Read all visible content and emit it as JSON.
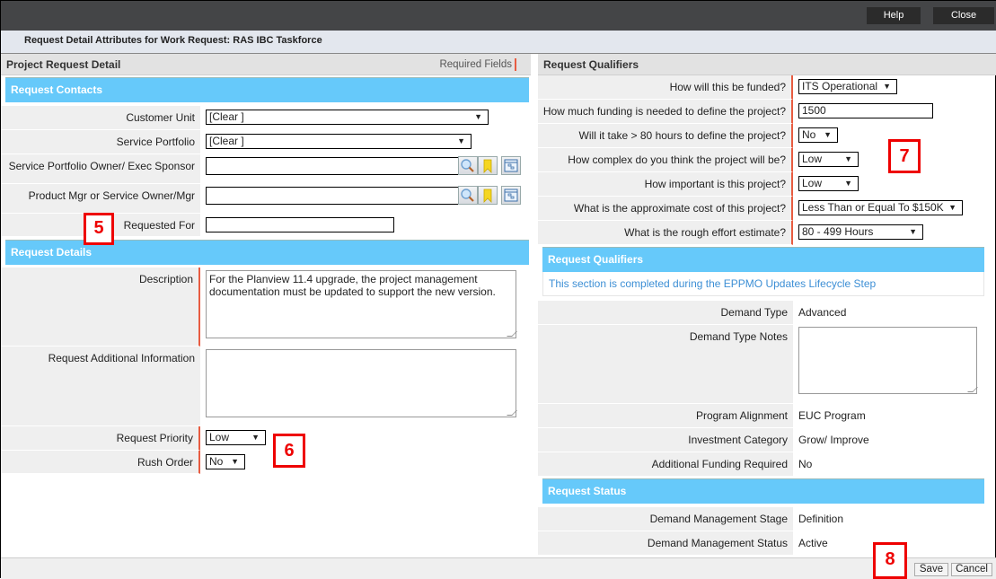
{
  "topbar": {
    "help_label": "Help",
    "close_label": "Close"
  },
  "subbar": {
    "title": "Request Detail Attributes for Work Request: RAS IBC Taskforce"
  },
  "left": {
    "panel_title": "Project Request Detail",
    "required_fields": "Required Fields",
    "contacts": {
      "section_title": "Request Contacts",
      "customer_unit": {
        "label": "Customer Unit",
        "value": "[Clear ]"
      },
      "service_portfolio": {
        "label": "Service Portfolio",
        "value": "[Clear ]"
      },
      "portfolio_owner": {
        "label": "Service Portfolio Owner/ Exec Sponsor",
        "value": ""
      },
      "product_mgr": {
        "label": "Product Mgr or Service Owner/Mgr",
        "value": ""
      },
      "requested_for": {
        "label": "Requested For",
        "value": ""
      }
    },
    "details": {
      "section_title": "Request Details",
      "description": {
        "label": "Description",
        "value": "For the Planview 11.4 upgrade, the project management documentation must be updated to support the new version."
      },
      "additional_info": {
        "label": "Request Additional Information",
        "value": ""
      },
      "priority": {
        "label": "Request Priority",
        "value": "Low"
      },
      "rush_order": {
        "label": "Rush Order",
        "value": "No"
      }
    }
  },
  "right": {
    "panel_title": "Request Qualifiers",
    "questions": [
      {
        "label": "How will this be funded?",
        "value": "ITS Operational"
      },
      {
        "label": "How much funding is needed to define the project?",
        "value": "1500"
      },
      {
        "label": "Will it take > 80 hours to define the project?",
        "value": "No"
      },
      {
        "label": "How complex do you think the project will be?",
        "value": "Low"
      },
      {
        "label": "How important is this project?",
        "value": "Low"
      },
      {
        "label": "What is the approximate cost of this project?",
        "value": "Less Than or Equal To $150K"
      },
      {
        "label": "What is the rough effort estimate?",
        "value": "80 - 499 Hours"
      }
    ],
    "qualifiers_section": {
      "title": "Request Qualifiers",
      "info": "This section is completed during the EPPMO Updates Lifecycle Step",
      "demand_type": {
        "label": "Demand Type",
        "value": "Advanced"
      },
      "demand_type_notes": {
        "label": "Demand Type Notes",
        "value": ""
      },
      "program_alignment": {
        "label": "Program Alignment",
        "value": "EUC Program"
      },
      "investment_category": {
        "label": "Investment Category",
        "value": "Grow/ Improve"
      },
      "additional_funding": {
        "label": "Additional Funding Required",
        "value": "No"
      }
    },
    "status_section": {
      "title": "Request Status",
      "stage": {
        "label": "Demand Management Stage",
        "value": "Definition"
      },
      "status": {
        "label": "Demand Management Status",
        "value": "Active"
      }
    }
  },
  "annotations": {
    "five": "5",
    "six": "6",
    "seven": "7",
    "eight": "8"
  },
  "footer": {
    "save_label": "Save",
    "cancel_label": "Cancel"
  },
  "icons": {
    "dropdown": "▼"
  }
}
